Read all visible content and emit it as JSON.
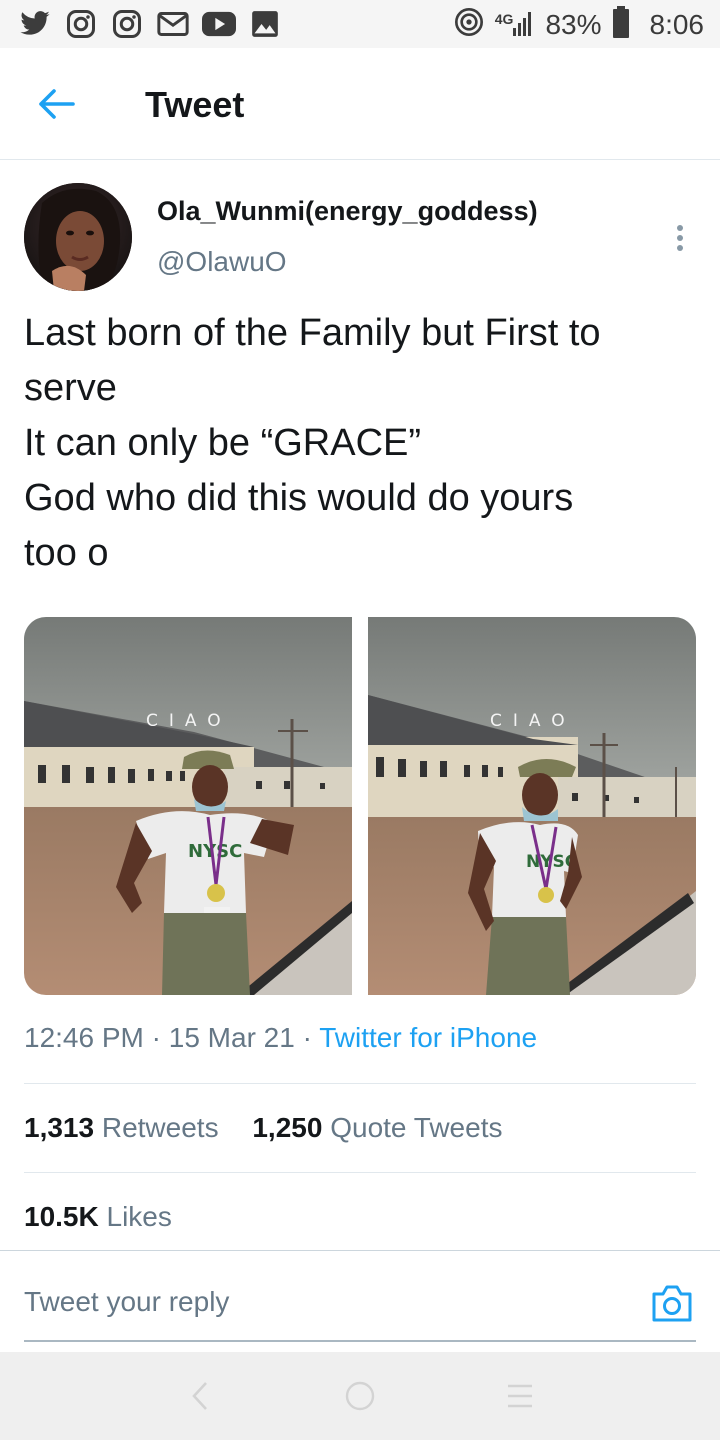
{
  "status_bar": {
    "icons": [
      "twitter-icon",
      "instagram-icon",
      "instagram-icon",
      "gmail-icon",
      "youtube-icon",
      "gallery-icon"
    ],
    "network": "4G",
    "battery": "83%",
    "time": "8:06"
  },
  "header": {
    "title": "Tweet"
  },
  "tweet": {
    "display_name": "Ola_Wunmi(energy_goddess)",
    "handle": "@OlawuO",
    "text_lines": [
      "Last born of the Family but First to",
      "serve",
      "It can only be “GRACE”",
      "God who did this would do yours",
      "too o"
    ],
    "media_overlay_left": "CIAO",
    "media_overlay_right": "CIAO",
    "time": "12:46 PM",
    "date": "15 Mar 21",
    "source": "Twitter for iPhone",
    "retweets_count": "1,313",
    "retweets_label": "Retweets",
    "quote_count": "1,250",
    "quote_label": "Quote Tweets",
    "likes_count": "10.5K",
    "likes_label": "Likes"
  },
  "reply": {
    "placeholder": "Tweet your reply"
  },
  "colors": {
    "accent": "#1da1f2",
    "secondary_text": "#657786",
    "primary_text": "#14171a"
  }
}
